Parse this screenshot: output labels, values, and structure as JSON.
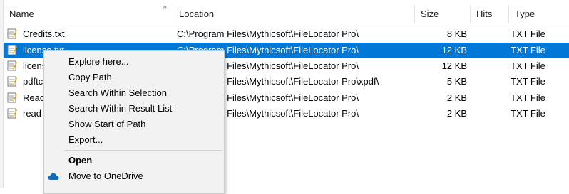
{
  "columns": {
    "name": "Name",
    "location": "Location",
    "size": "Size",
    "hits": "Hits",
    "type": "Type",
    "sort_indicator": "^"
  },
  "rows": [
    {
      "name": "Credits.txt",
      "location": "C:\\Program Files\\Mythicsoft\\FileLocator Pro\\",
      "size": "8 KB",
      "hits": "",
      "type": "TXT File",
      "selected": false
    },
    {
      "name": "license.txt",
      "location": "C:\\Program Files\\Mythicsoft\\FileLocator Pro\\",
      "size": "12 KB",
      "hits": "",
      "type": "TXT File",
      "selected": true
    },
    {
      "name": "licens",
      "location": "C:\\Program Files\\Mythicsoft\\FileLocator Pro\\",
      "size": "12 KB",
      "hits": "",
      "type": "TXT File",
      "selected": false
    },
    {
      "name": "pdftc",
      "location": "C:\\Program Files\\Mythicsoft\\FileLocator Pro\\xpdf\\",
      "size": "5 KB",
      "hits": "",
      "type": "TXT File",
      "selected": false
    },
    {
      "name": "Read",
      "location": "C:\\Program Files\\Mythicsoft\\FileLocator Pro\\",
      "size": "2 KB",
      "hits": "",
      "type": "TXT File",
      "selected": false
    },
    {
      "name": "read",
      "location": "C:\\Program Files\\Mythicsoft\\FileLocator Pro\\",
      "size": "2 KB",
      "hits": "",
      "type": "TXT File",
      "selected": false
    }
  ],
  "context_menu": {
    "items": [
      {
        "label": "Explore here..."
      },
      {
        "label": "Copy Path"
      },
      {
        "label": "Search Within Selection"
      },
      {
        "label": "Search Within Result List"
      },
      {
        "label": "Show Start of Path"
      },
      {
        "label": "Export..."
      },
      {
        "label": "Open"
      },
      {
        "label": "Move to OneDrive"
      }
    ]
  },
  "colors": {
    "selection": "#0078d7",
    "menu_background": "#f2f2f2",
    "onedrive": "#0f6cbd"
  },
  "icons": {
    "file": "text-file-icon",
    "onedrive": "onedrive-cloud-icon"
  }
}
